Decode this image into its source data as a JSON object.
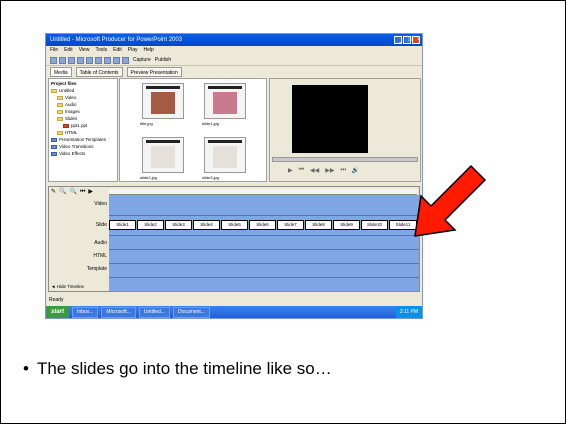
{
  "window": {
    "title": "Untitled - Microsoft Producer for PowerPoint 2003",
    "menu": [
      "File",
      "Edit",
      "View",
      "Tools",
      "Edit",
      "Play",
      "Help"
    ],
    "toolbar_buttons": [
      "Capture",
      "Publish"
    ],
    "controls": [
      "_",
      "□",
      "×"
    ]
  },
  "tabs": [
    "Media",
    "Table of Contents",
    "Preview Presentation"
  ],
  "project_files": {
    "title": "Project files",
    "items": [
      "Untitled",
      "Video",
      "Audio",
      "Images",
      "Slides",
      "ppt1.ppt",
      "HTML",
      "Presentation Templates",
      "Video Transitions",
      "Video Effects"
    ]
  },
  "thumbnails": [
    {
      "caption": "title.jpg"
    },
    {
      "caption": "slide1.jpg"
    },
    {
      "caption": "slide2.jpg"
    },
    {
      "caption": "slide3.jpg"
    }
  ],
  "player": {
    "controls": [
      "▶",
      "⏮",
      "◀◀",
      "▶▶",
      "⏭",
      "🔊"
    ]
  },
  "timeline": {
    "tools": [
      "✎",
      "🔍",
      "🔍",
      "⏮",
      "▶"
    ],
    "track_labels": [
      "Video",
      "Slide",
      "Audio",
      "HTML",
      "Template"
    ],
    "clips": [
      "Slide1",
      "Slide2",
      "Slide3",
      "Slide4",
      "Slide5",
      "Slide6",
      "Slide7",
      "Slide8",
      "Slide9",
      "Slide10",
      "Slide11"
    ],
    "show_timeline": "◄ Hide Timeline"
  },
  "statusbar": "Ready",
  "taskbar": {
    "start": "start",
    "items": [
      "Inbox...",
      "Microsoft...",
      "Untitled...",
      "Document..."
    ],
    "clock": "3:11 PM"
  },
  "slide_text": {
    "bullet": "The slides go into the timeline like so…"
  }
}
